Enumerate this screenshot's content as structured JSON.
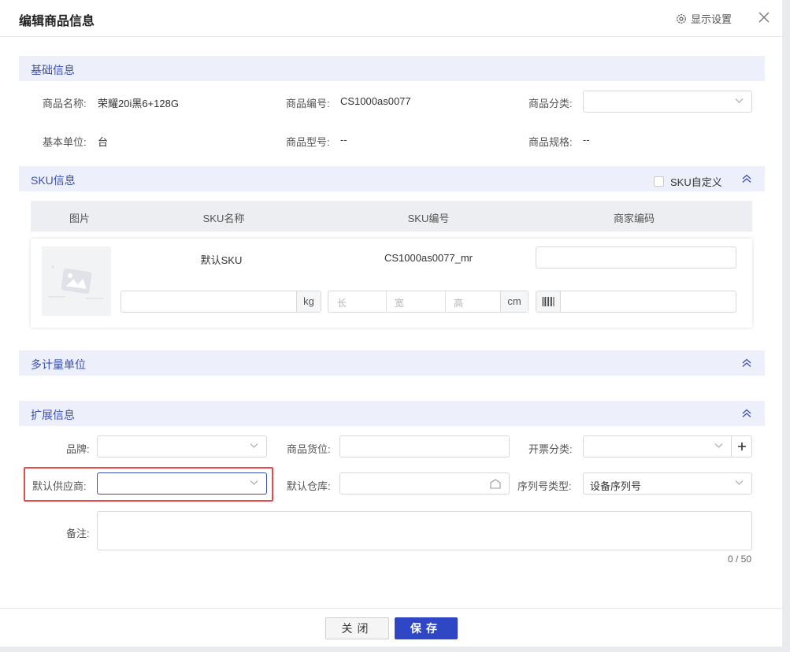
{
  "dialog": {
    "title": "编辑商品信息",
    "display_settings": "显示设置"
  },
  "basic": {
    "section_title": "基础信息",
    "name_label": "商品名称:",
    "name_value": "荣耀20i黑6+128G",
    "code_label": "商品编号:",
    "code_value": "CS1000as0077",
    "category_label": "商品分类:",
    "category_value": "",
    "unit_label": "基本单位:",
    "unit_value": "台",
    "model_label": "商品型号:",
    "model_value": "--",
    "spec_label": "商品规格:",
    "spec_value": "--"
  },
  "sku": {
    "section_title": "SKU信息",
    "custom_label": "SKU自定义",
    "custom_checked": false,
    "columns": [
      "图片",
      "SKU名称",
      "SKU编号",
      "商家编码"
    ],
    "row": {
      "name": "默认SKU",
      "code": "CS1000as0077_mr",
      "merchant_code": "",
      "weight_unit": "kg",
      "length_placeholder": "长",
      "width_placeholder": "宽",
      "height_placeholder": "高",
      "size_unit": "cm"
    }
  },
  "multi_unit": {
    "section_title": "多计量单位"
  },
  "extended": {
    "section_title": "扩展信息",
    "brand_label": "品牌:",
    "location_label": "商品货位:",
    "invoice_label": "开票分类:",
    "supplier_label": "默认供应商:",
    "warehouse_label": "默认仓库:",
    "serial_type_label": "序列号类型:",
    "serial_type_value": "设备序列号",
    "remark_label": "备注:",
    "remark_counter": "0 / 50"
  },
  "footer": {
    "close_label": "关闭",
    "save_label": "保存"
  },
  "colors": {
    "accent": "#2f47c4",
    "section_bg": "#edf0fb",
    "section_text": "#3a4fb4",
    "highlight": "#e84a4a"
  }
}
